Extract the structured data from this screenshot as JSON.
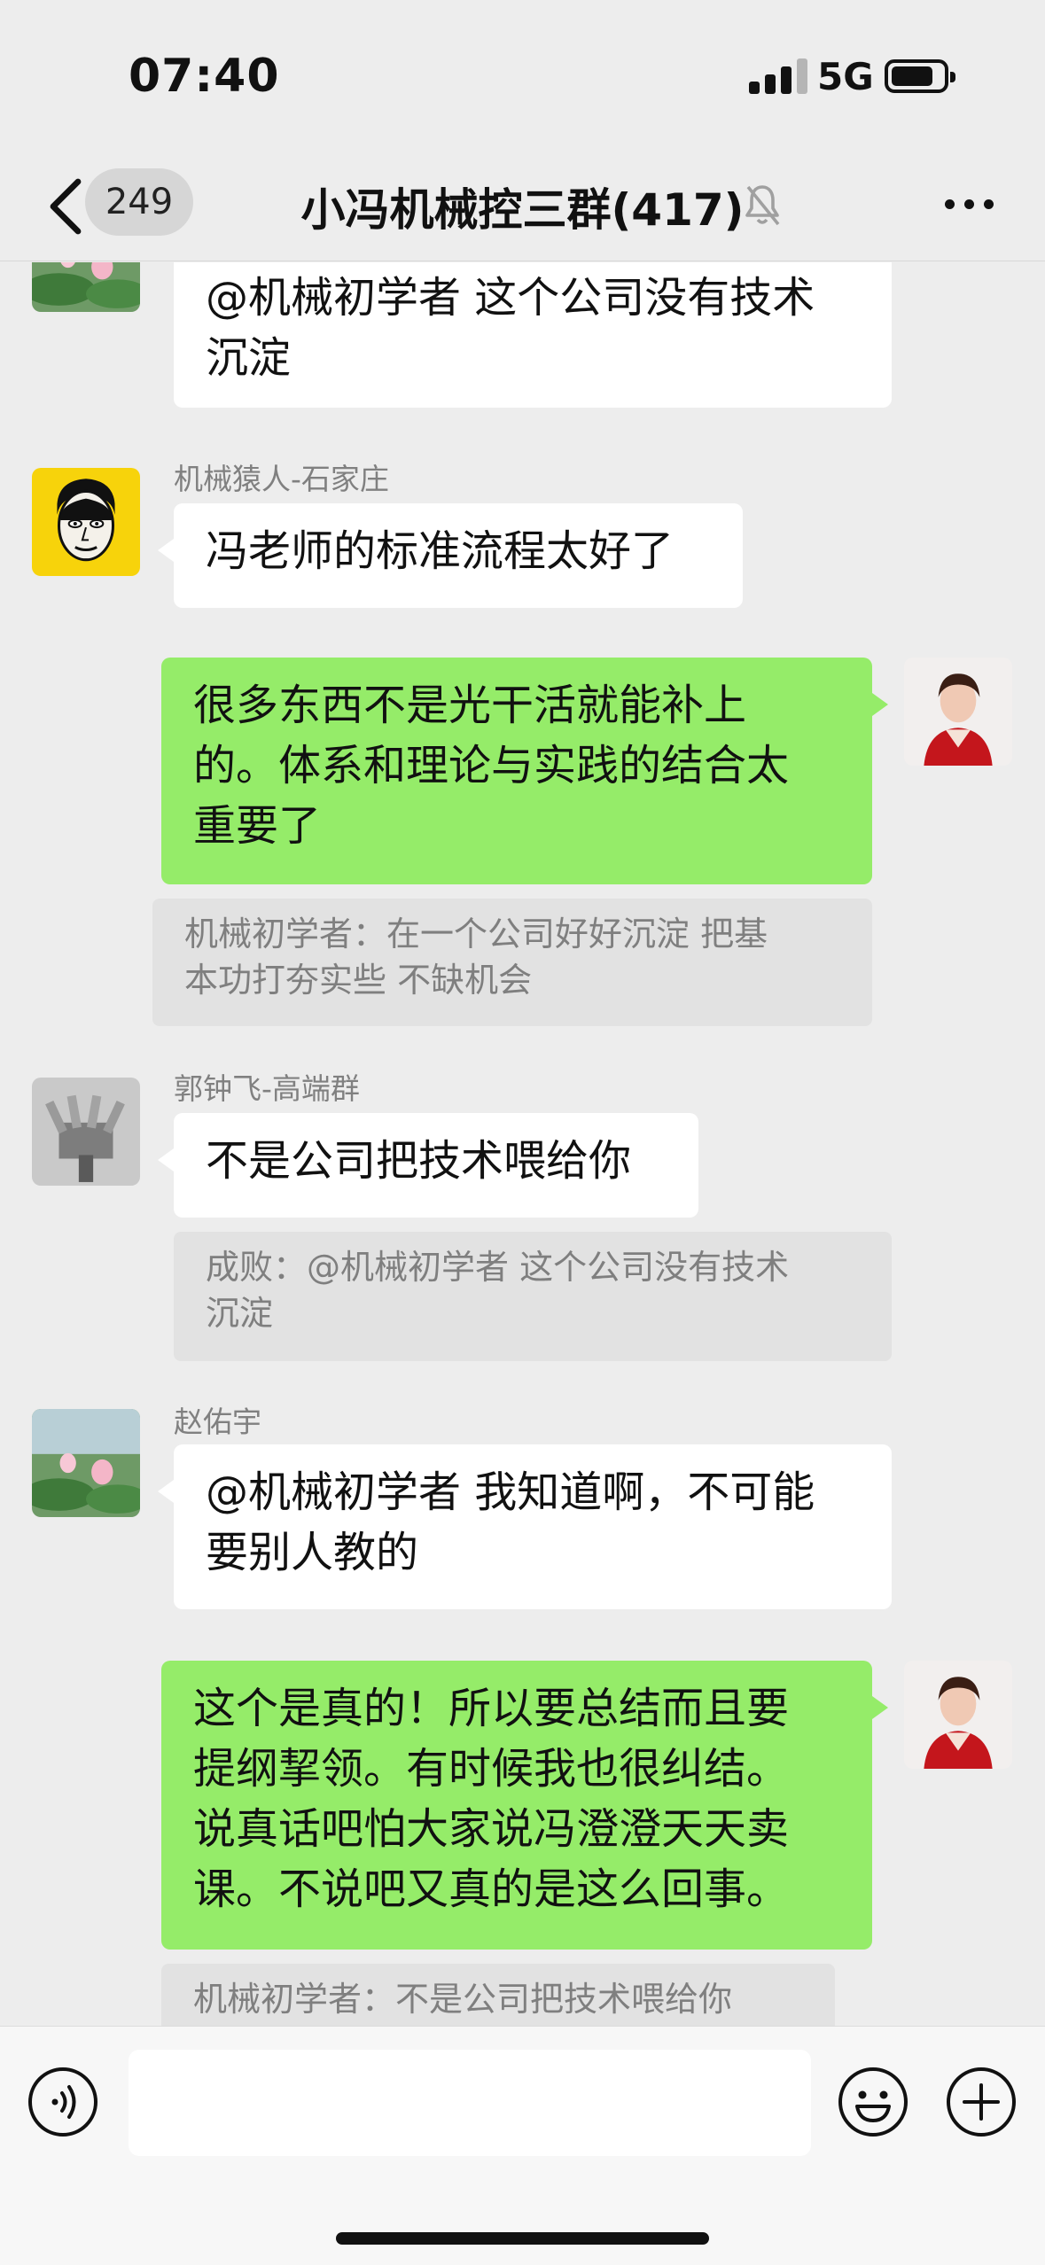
{
  "status_bar": {
    "time": "07:40",
    "network": "5G",
    "battery_level": 0.8
  },
  "nav": {
    "unread_count": "249",
    "title": "小冯机械控三群(417)",
    "muted": true
  },
  "messages": [
    {
      "direction": "in",
      "sender": "",
      "avatar": "lotus",
      "text_lines": [
        "@机械初学者 这个公司没有技术",
        "沉淀"
      ]
    },
    {
      "direction": "in",
      "sender": "机械猿人-石家庄",
      "avatar": "cartoon-face",
      "text_lines": [
        "冯老师的标准流程太好了"
      ]
    },
    {
      "direction": "out",
      "avatar": "woman-red",
      "text_lines": [
        "很多东西不是光干活就能补上",
        "的。体系和理论与实践的结合太",
        "重要了"
      ],
      "quote_lines": [
        "机械初学者：在一个公司好好沉淀 把基",
        "本功打夯实些 不缺机会"
      ]
    },
    {
      "direction": "in",
      "sender": "郭钟飞-高端群",
      "avatar": "engine",
      "text_lines": [
        "不是公司把技术喂给你"
      ],
      "quote_lines": [
        "成败：@机械初学者 这个公司没有技术",
        "沉淀"
      ]
    },
    {
      "direction": "in",
      "sender": "赵佑宇",
      "avatar": "lotus",
      "text_lines": [
        "@机械初学者 我知道啊，不可能",
        "要别人教的"
      ]
    },
    {
      "direction": "out",
      "avatar": "woman-red",
      "text_lines": [
        "这个是真的！所以要总结而且要",
        "提纲挈领。有时候我也很纠结。",
        "说真话吧怕大家说冯澄澄天天卖",
        "课。不说吧又真的是这么回事。"
      ],
      "quote_lines": [
        "机械初学者：不是公司把技术喂给你"
      ]
    }
  ],
  "input": {
    "value": "",
    "icons": [
      "voice-icon",
      "emoji-icon",
      "plus-icon"
    ]
  },
  "colors": {
    "background": "#ededed",
    "outgoing_bubble": "#95ec69",
    "incoming_bubble": "#ffffff",
    "quote_bg": "#e2e2e2"
  }
}
